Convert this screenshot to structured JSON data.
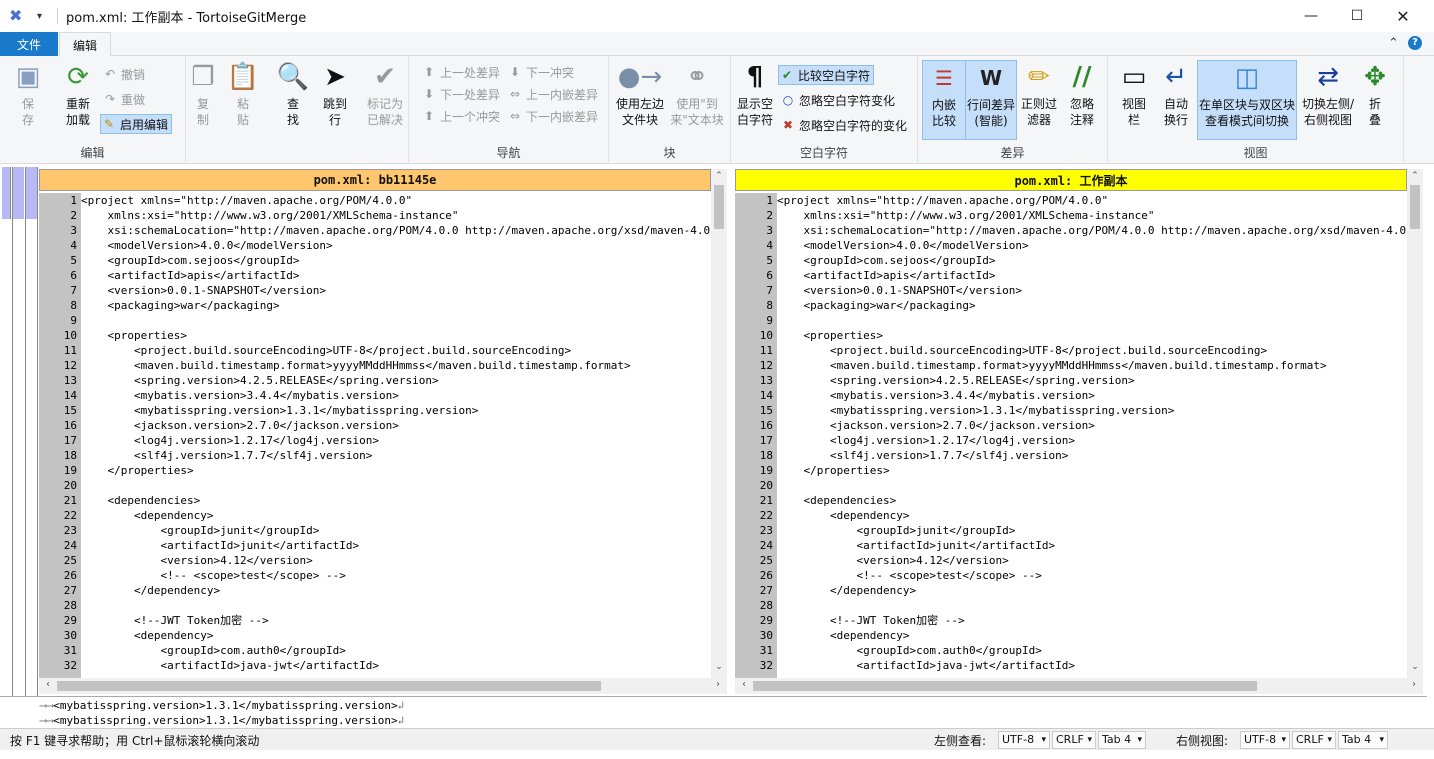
{
  "window": {
    "title": "pom.xml: 工作副本 - TortoiseGitMerge"
  },
  "tabs": {
    "file": "文件",
    "edit": "编辑"
  },
  "ribbon": {
    "edit_group": {
      "label": "编辑",
      "save": "保存",
      "reload": "重新加载",
      "undo": "撤销",
      "redo": "重做",
      "enable_edit": "启用编辑",
      "copy": "复制",
      "paste": "粘贴",
      "find": "查找",
      "goto": "跳到行",
      "mark_resolved": "标记为已解决"
    },
    "nav_group": {
      "label": "导航",
      "prev_diff": "上一处差异",
      "next_diff": "下一处差异",
      "prev_conflict": "上一个冲突",
      "next_conflict": "下一冲突",
      "prev_inline": "上一内嵌差异",
      "next_inline": "下一内嵌差异"
    },
    "block_group": {
      "label": "块",
      "use_left": "使用左边文件块",
      "use_theirs": "使用\"到来\"文本块"
    },
    "ws_group": {
      "label": "空白字符",
      "show_ws": "显示空白字符",
      "compare_ws": "比较空白字符",
      "ignore_ws_change": "忽略空白字符变化",
      "ignore_all_ws": "忽略空白字符的变化"
    },
    "diff_group": {
      "label": "差异",
      "inline_compare": "内嵌比较",
      "line_diff": "行间差异(智能)",
      "regex_filter": "正则过滤器",
      "ignore_comments": "忽略注释"
    },
    "view_group": {
      "label": "视图",
      "viewbar": "视图栏",
      "auto_wrap": "自动换行",
      "toggle_mode": "在单区块与双区块查看模式间切换",
      "switch_lr": "切换左侧/右侧视图",
      "fold": "折叠"
    }
  },
  "left_pane": {
    "header": "pom.xml: bb11145e"
  },
  "right_pane": {
    "header": "pom.xml: 工作副本"
  },
  "code_lines": [
    {
      "n": "1",
      "t": "<project xmlns=\"http://maven.apache.org/POM/4.0.0\""
    },
    {
      "n": "2",
      "t": "    xmlns:xsi=\"http://www.w3.org/2001/XMLSchema-instance\""
    },
    {
      "n": "3",
      "t": "    xsi:schemaLocation=\"http://maven.apache.org/POM/4.0.0 http://maven.apache.org/xsd/maven-4.0.0.xsd\">"
    },
    {
      "n": "4",
      "t": "    <modelVersion>4.0.0</modelVersion>"
    },
    {
      "n": "5",
      "t": "    <groupId>com.sejoos</groupId>"
    },
    {
      "n": "6",
      "t": "    <artifactId>apis</artifactId>"
    },
    {
      "n": "7",
      "t": "    <version>0.0.1-SNAPSHOT</version>"
    },
    {
      "n": "8",
      "t": "    <packaging>war</packaging>"
    },
    {
      "n": "9",
      "t": ""
    },
    {
      "n": "10",
      "t": "    <properties>"
    },
    {
      "n": "11",
      "t": "        <project.build.sourceEncoding>UTF-8</project.build.sourceEncoding>"
    },
    {
      "n": "12",
      "t": "        <maven.build.timestamp.format>yyyyMMddHHmmss</maven.build.timestamp.format>"
    },
    {
      "n": "13",
      "t": "        <spring.version>4.2.5.RELEASE</spring.version>"
    },
    {
      "n": "14",
      "t": "        <mybatis.version>3.4.4</mybatis.version>"
    },
    {
      "n": "15",
      "t": "        <mybatisspring.version>1.3.1</mybatisspring.version>"
    },
    {
      "n": "16",
      "t": "        <jackson.version>2.7.0</jackson.version>"
    },
    {
      "n": "17",
      "t": "        <log4j.version>1.2.17</log4j.version>"
    },
    {
      "n": "18",
      "t": "        <slf4j.version>1.7.7</slf4j.version>"
    },
    {
      "n": "19",
      "t": "    </properties>"
    },
    {
      "n": "20",
      "t": ""
    },
    {
      "n": "21",
      "t": "    <dependencies>"
    },
    {
      "n": "22",
      "t": "        <dependency>"
    },
    {
      "n": "23",
      "t": "            <groupId>junit</groupId>"
    },
    {
      "n": "24",
      "t": "            <artifactId>junit</artifactId>"
    },
    {
      "n": "25",
      "t": "            <version>4.12</version>"
    },
    {
      "n": "26",
      "t": "            <!-- <scope>test</scope> -->"
    },
    {
      "n": "27",
      "t": "        </dependency>"
    },
    {
      "n": "28",
      "t": ""
    },
    {
      "n": "29",
      "t": "        <!--JWT Token加密 -->"
    },
    {
      "n": "30",
      "t": "        <dependency>"
    },
    {
      "n": "31",
      "t": "            <groupId>com.auth0</groupId>"
    },
    {
      "n": "32",
      "t": "            <artifactId>java-jwt</artifactId>"
    }
  ],
  "bottom_pane": {
    "line1": "<mybatisspring.version>1.3.1</mybatisspring.version>",
    "line2": "<mybatisspring.version>1.3.1</mybatisspring.version>"
  },
  "status": {
    "help": "按 F1 键寻求帮助；用 Ctrl+鼠标滚轮横向滚动",
    "left_view": "左侧查看:",
    "right_view": "右侧视图:",
    "left_enc": "UTF-8",
    "left_eol": "CRLF",
    "left_tab": "Tab 4",
    "right_enc": "UTF-8",
    "right_eol": "CRLF",
    "right_tab": "Tab 4"
  }
}
